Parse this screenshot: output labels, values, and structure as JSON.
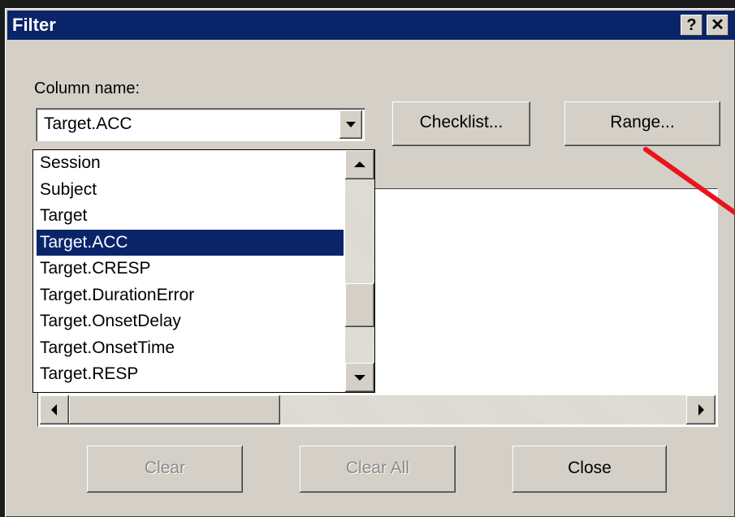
{
  "dialog": {
    "title": "Filter",
    "help_icon": "question-mark-icon",
    "close_icon": "close-icon",
    "help_label": "?",
    "close_label": "✕"
  },
  "column": {
    "label": "Column name:",
    "selected": "Target.ACC"
  },
  "buttons": {
    "checklist": "Checklist...",
    "range": "Range...",
    "clear": "Clear",
    "clear_all": "Clear All",
    "close": "Close"
  },
  "dropdown": {
    "options": [
      "Session",
      "Subject",
      "Target",
      "Target.ACC",
      "Target.CRESP",
      "Target.DurationError",
      "Target.OnsetDelay",
      "Target.OnsetTime",
      "Target.RESP"
    ],
    "selected_index": 3
  },
  "annotation": {
    "arrow_color": "#e8141c"
  },
  "colors": {
    "titlebar": "#0a246a",
    "face": "#d4d0c8",
    "selection": "#0a246a"
  }
}
